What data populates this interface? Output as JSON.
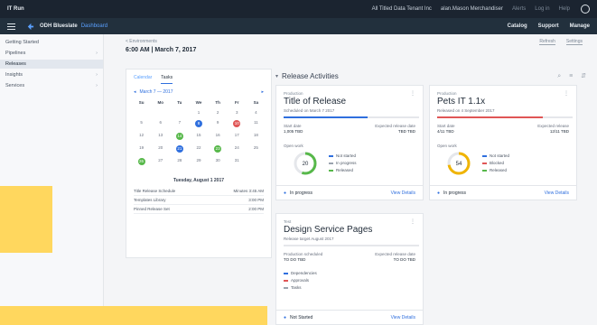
{
  "topbar": {
    "brand": "IT Run",
    "org": "All Titled Data Tenant Inc",
    "user": "alan.Mason Merchandiser",
    "links": [
      "Alerts",
      "Log in",
      "Help"
    ]
  },
  "navbar": {
    "app_name": "ODH Blueslate",
    "app_sub": "Dashboard",
    "links": [
      "Catalog",
      "Support",
      "Manage"
    ]
  },
  "sidebar": {
    "items": [
      {
        "label": "Getting Started",
        "chev": ""
      },
      {
        "label": "Pipelines",
        "chev": "›"
      },
      {
        "label": "Releases",
        "chev": ""
      },
      {
        "label": "Insights",
        "chev": "›"
      },
      {
        "label": "Services",
        "chev": "›"
      }
    ]
  },
  "page": {
    "crumb": "< Environments",
    "title": "6:00 AM | March 7, 2017",
    "actions": [
      "Refresh",
      "Settings"
    ]
  },
  "calendar": {
    "tabs": [
      "Calendar",
      "Tasks"
    ],
    "month": "March 7 — 2017",
    "days": [
      "Su",
      "Mo",
      "Tu",
      "We",
      "Th",
      "Fr",
      "Sa"
    ],
    "dates": [
      "",
      "",
      "",
      "1",
      "2",
      "3",
      "4",
      "5",
      "6",
      "7",
      "8",
      "9",
      "10",
      "11",
      "12",
      "13",
      "14",
      "15",
      "16",
      "17",
      "18",
      "19",
      "20",
      "21",
      "22",
      "23",
      "24",
      "25",
      "26",
      "27",
      "28",
      "29",
      "30",
      "31",
      ""
    ],
    "event_title": "Tuesday, August 1 2017",
    "events": [
      {
        "name": "Title Release Schedule",
        "time": "Minutes 3:45 AM"
      },
      {
        "name": "Templates Library",
        "time": "3:00 PM"
      },
      {
        "name": "Pinned Release Set",
        "time": "2:00 PM"
      }
    ]
  },
  "activities": {
    "title": "Release Activities",
    "tools": [
      "⌕",
      "≡",
      "⇵"
    ],
    "cards": [
      {
        "kind": "Production",
        "title": "Title of Release",
        "sub": "Scheduled on March 7 2017",
        "progress": 0.62,
        "bar_color": "#2f6fde",
        "meta_left_label": "Start date",
        "meta_left_value": "1,005 TBD",
        "meta_right_label": "Expected release date",
        "meta_right_value": "TBD TBD",
        "gauge_label": "Open work",
        "gauge_value": "20",
        "gauge_fraction": 0.55,
        "gauge_color": "#57b84a",
        "legend": [
          {
            "label": "Not started",
            "color": "#2f6fde"
          },
          {
            "label": "In progress",
            "color": "#9aa3ae"
          },
          {
            "label": "Released",
            "color": "#57b84a"
          }
        ],
        "status": "In progress",
        "action": "View Details"
      },
      {
        "kind": "Production",
        "title": "Pets IT 1.1x",
        "sub": "Released on 4 September 2017",
        "progress": 0.78,
        "bar_color": "#e05656",
        "meta_left_label": "Start date",
        "meta_left_value": "4/11 TBD",
        "meta_right_label": "Expected release",
        "meta_right_value": "12/11 TBD",
        "gauge_label": "Open work",
        "gauge_value": "54",
        "gauge_fraction": 0.72,
        "gauge_color": "#f0b400",
        "legend": [
          {
            "label": "Not started",
            "color": "#2f6fde"
          },
          {
            "label": "Blocked",
            "color": "#e05656"
          },
          {
            "label": "Released",
            "color": "#57b84a"
          }
        ],
        "status": "In progress",
        "action": "View Details"
      },
      {
        "kind": "Test",
        "title": "Design Service Pages",
        "sub": "Release target August 2017",
        "progress": 0.0,
        "bar_color": "#2f6fde",
        "meta_left_label": "Production scheduled",
        "meta_left_value": "TO DO TBD",
        "meta_right_label": "Expected release date",
        "meta_right_value": "TO DO TBD",
        "gauge_label": "",
        "gauge_value": "",
        "gauge_fraction": 0,
        "gauge_color": "#2f6fde",
        "legend": [
          {
            "label": "Dependencies",
            "color": "#2f6fde"
          },
          {
            "label": "Approvals",
            "color": "#e05656"
          },
          {
            "label": "Tasks",
            "color": "#9aa3ae"
          }
        ],
        "status": "Not Started",
        "action": "View Details"
      }
    ]
  }
}
